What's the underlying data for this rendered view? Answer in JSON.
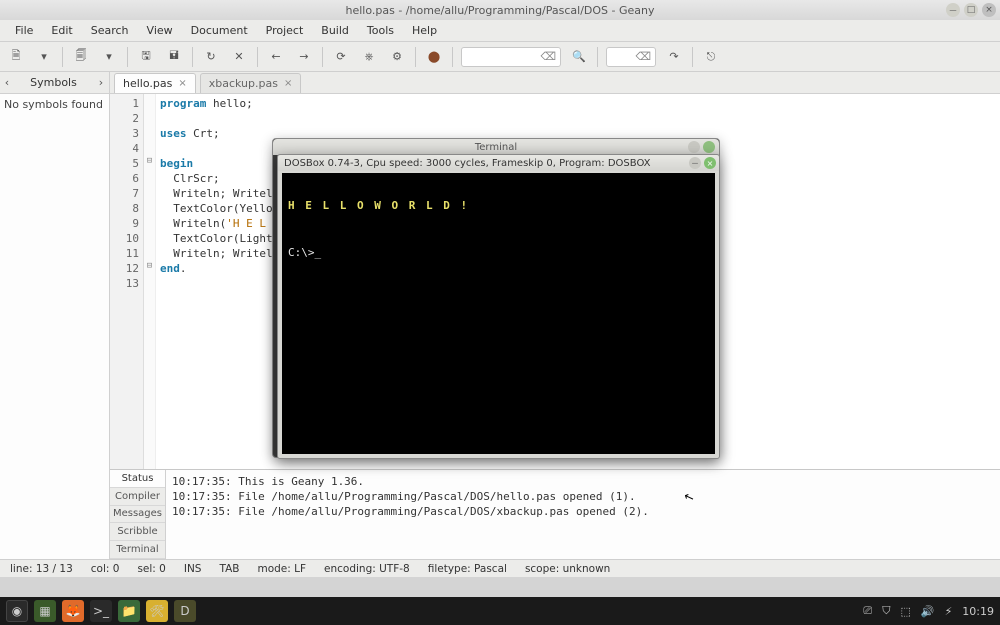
{
  "window": {
    "title": "hello.pas - /home/allu/Programming/Pascal/DOS - Geany",
    "minimize": "－",
    "maximize": "□",
    "close": "×"
  },
  "menu": {
    "file": "File",
    "edit": "Edit",
    "search": "Search",
    "view": "View",
    "document": "Document",
    "project": "Project",
    "build": "Build",
    "tools": "Tools",
    "help": "Help"
  },
  "symbols": {
    "header": "Symbols",
    "empty": "No symbols found"
  },
  "tabs": {
    "t0": {
      "label": "hello.pas"
    },
    "t1": {
      "label": "xbackup.pas"
    }
  },
  "code": {
    "gutter": "1\n2\n3\n4\n5\n6\n7\n8\n9\n10\n11\n12\n13",
    "fold": " \n \n \n \n⊟\n \n \n \n \n \n \n⊟\n ",
    "l1a": "program",
    "l1b": " hello;",
    "l3a": "uses",
    "l3b": " Crt;",
    "l5a": "begin",
    "l6": "  ClrScr;",
    "l7": "  Writeln; Writeln;",
    "l8": "  TextColor(Yellow);",
    "l9a": "  Writeln(",
    "l9b": "'H E L L O   W O R L D !'",
    "l9c": ");",
    "l10": "  TextColor(LightGray);",
    "l11": "  Writeln; Writeln;",
    "l12a": "end",
    "l12b": "."
  },
  "bottom": {
    "tabs": {
      "status": "Status",
      "compiler": "Compiler",
      "messages": "Messages",
      "scribble": "Scribble",
      "terminal": "Terminal"
    },
    "l1": "10:17:35: This is Geany 1.36.",
    "l2": "10:17:35: File /home/allu/Programming/Pascal/DOS/hello.pas opened (1).",
    "l3": "10:17:35: File /home/allu/Programming/Pascal/DOS/xbackup.pas opened (2)."
  },
  "status": {
    "line": "line: 13 / 13",
    "col": "col: 0",
    "sel": "sel: 0",
    "ins": "INS",
    "tab": "TAB",
    "mode": "mode: LF",
    "enc": "encoding: UTF-8",
    "ftype": "filetype: Pascal",
    "scope": "scope: unknown"
  },
  "terminal_bg": {
    "title": "Terminal"
  },
  "dosbox": {
    "title": "DOSBox 0.74-3, Cpu speed:    3000 cycles, Frameskip  0, Program:   DOSBOX",
    "hello": "H E L L O   W O R L D !",
    "prompt": "C:\\>_"
  },
  "taskbar": {
    "time": "10:19"
  }
}
